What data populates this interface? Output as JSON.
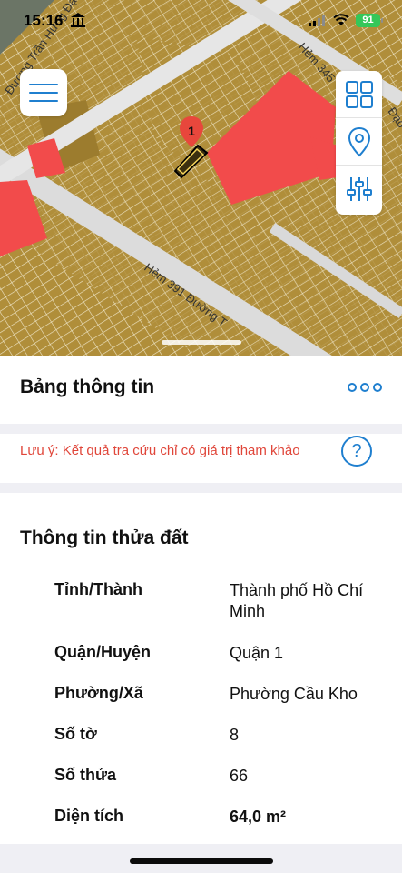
{
  "status_bar": {
    "time": "15:16",
    "battery": "91"
  },
  "map": {
    "street_labels": [
      "Đường Trần Hưng Đạo",
      "Hẻm 345",
      "Hẻm 391 Đường T",
      "Đạo"
    ],
    "marker_label": "1",
    "colors": {
      "parcel": "#b08e3a",
      "highlight": "#f24b4b",
      "road": "#d9d9d9",
      "accent": "#1f7fcf"
    },
    "tools": [
      "grid-icon",
      "location-pin-icon",
      "sliders-icon"
    ]
  },
  "panel": {
    "title": "Bảng thông tin",
    "note": "Lưu ý: Kết quả tra cứu chỉ có giá trị tham khảo",
    "help_label": "?"
  },
  "parcel_info": {
    "title": "Thông tin thửa đất",
    "rows": [
      {
        "label": "Tỉnh/Thành",
        "value": "Thành phố Hồ Chí Minh"
      },
      {
        "label": "Quận/Huyện",
        "value": "Quận 1"
      },
      {
        "label": "Phường/Xã",
        "value": "Phường Cầu Kho"
      },
      {
        "label": "Số tờ",
        "value": "8"
      },
      {
        "label": "Số thửa",
        "value": "66"
      },
      {
        "label": "Diện tích",
        "value": "64,0 m²"
      }
    ]
  }
}
